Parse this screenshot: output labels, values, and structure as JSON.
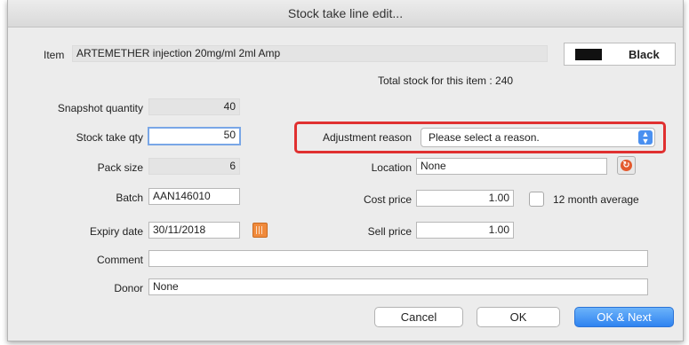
{
  "window": {
    "title": "Stock take line edit..."
  },
  "item": {
    "label": "Item",
    "value": "ARTEMETHER injection 20mg/ml 2ml Amp",
    "color_name": "Black",
    "swatch_color": "#111111",
    "total_stock": "Total stock for this item : 240"
  },
  "form": {
    "snapshot_label": "Snapshot quantity",
    "snapshot_value": "40",
    "stocktake_label": "Stock take qty",
    "stocktake_value": "50",
    "packsize_label": "Pack size",
    "packsize_value": "6",
    "batch_label": "Batch",
    "batch_value": "AAN146010",
    "expiry_label": "Expiry date",
    "expiry_value": "30/11/2018",
    "comment_label": "Comment",
    "comment_value": "",
    "donor_label": "Donor",
    "donor_value": "None",
    "adjustment_label": "Adjustment reason",
    "adjustment_value": "Please select a reason.",
    "location_label": "Location",
    "location_value": "None",
    "cost_label": "Cost price",
    "cost_value": "1.00",
    "avg_label": "12 month average",
    "sell_label": "Sell price",
    "sell_value": "1.00"
  },
  "buttons": {
    "cancel": "Cancel",
    "ok": "OK",
    "ok_next": "OK & Next"
  },
  "colors": {
    "highlight": "#e03030",
    "primary_button": "#2f83f0"
  }
}
